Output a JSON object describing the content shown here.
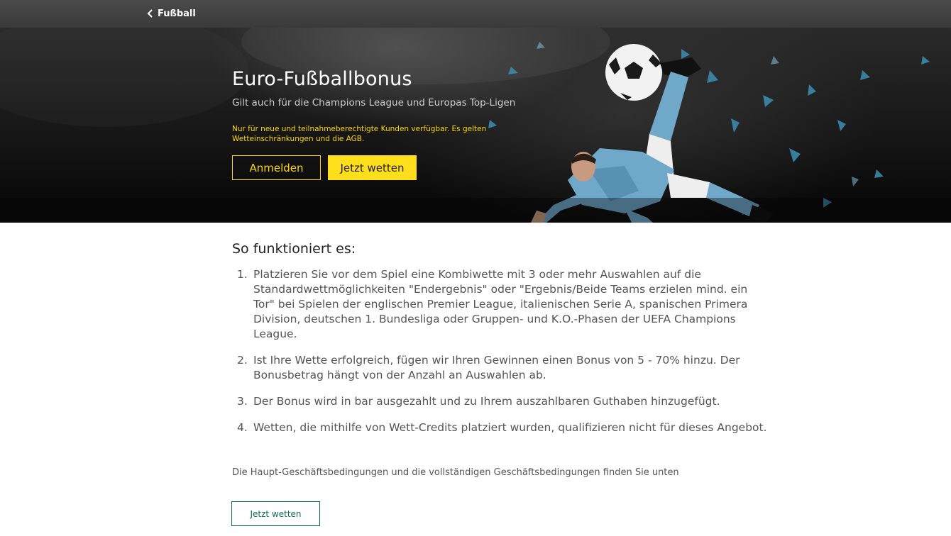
{
  "topbar": {
    "back_label": "Fußball"
  },
  "hero": {
    "title": "Euro-Fußballbonus",
    "subtitle": "Gilt auch für die Champions League und Europas Top-Ligen",
    "disclaimer": "Nur für neue und teilnahmeberechtigte Kunden verfügbar. Es gelten Wetteinschränkungen und die AGB.",
    "login_label": "Anmelden",
    "bet_label": "Jetzt wetten"
  },
  "content": {
    "section_title": "So funktioniert es:",
    "steps": [
      {
        "num": "1.",
        "text": "Platzieren Sie vor dem Spiel eine Kombiwette mit 3 oder mehr Auswahlen auf die Standardwettmöglichkeiten \"Endergebnis\" oder \"Ergebnis/Beide Teams erzielen mind. ein Tor\" bei Spielen der englischen Premier League, italienischen Serie A, spanischen Primera Division, deutschen 1. Bundesliga oder Gruppen- und K.O.-Phasen der UEFA Champions League."
      },
      {
        "num": "2.",
        "text": "Ist Ihre Wette erfolgreich, fügen wir Ihren Gewinnen einen Bonus von 5 - 70% hinzu. Der Bonusbetrag hängt von der Anzahl an Auswahlen ab."
      },
      {
        "num": "3.",
        "text": "Der Bonus wird in bar ausgezahlt und zu Ihrem auszahlbaren Guthaben hinzugefügt."
      },
      {
        "num": "4.",
        "text": "Wetten, die mithilfe von Wett-Credits platziert wurden, qualifizieren nicht für dieses Angebot."
      }
    ],
    "footnote": "Die Haupt-Geschäftsbedingungen und die vollständigen Geschäftsbedingungen finden Sie unten",
    "bottom_bet_label": "Jetzt wetten"
  },
  "colors": {
    "accent_yellow": "#ffdf1b",
    "accent_green": "#0c6b5b",
    "topbar": "#404040",
    "hero_bg": "#111111",
    "player_shirt": "#6fa8c9"
  },
  "icons": {
    "back": "chevron-left-icon",
    "hero_image": "footballer-bicycle-kick-image"
  }
}
